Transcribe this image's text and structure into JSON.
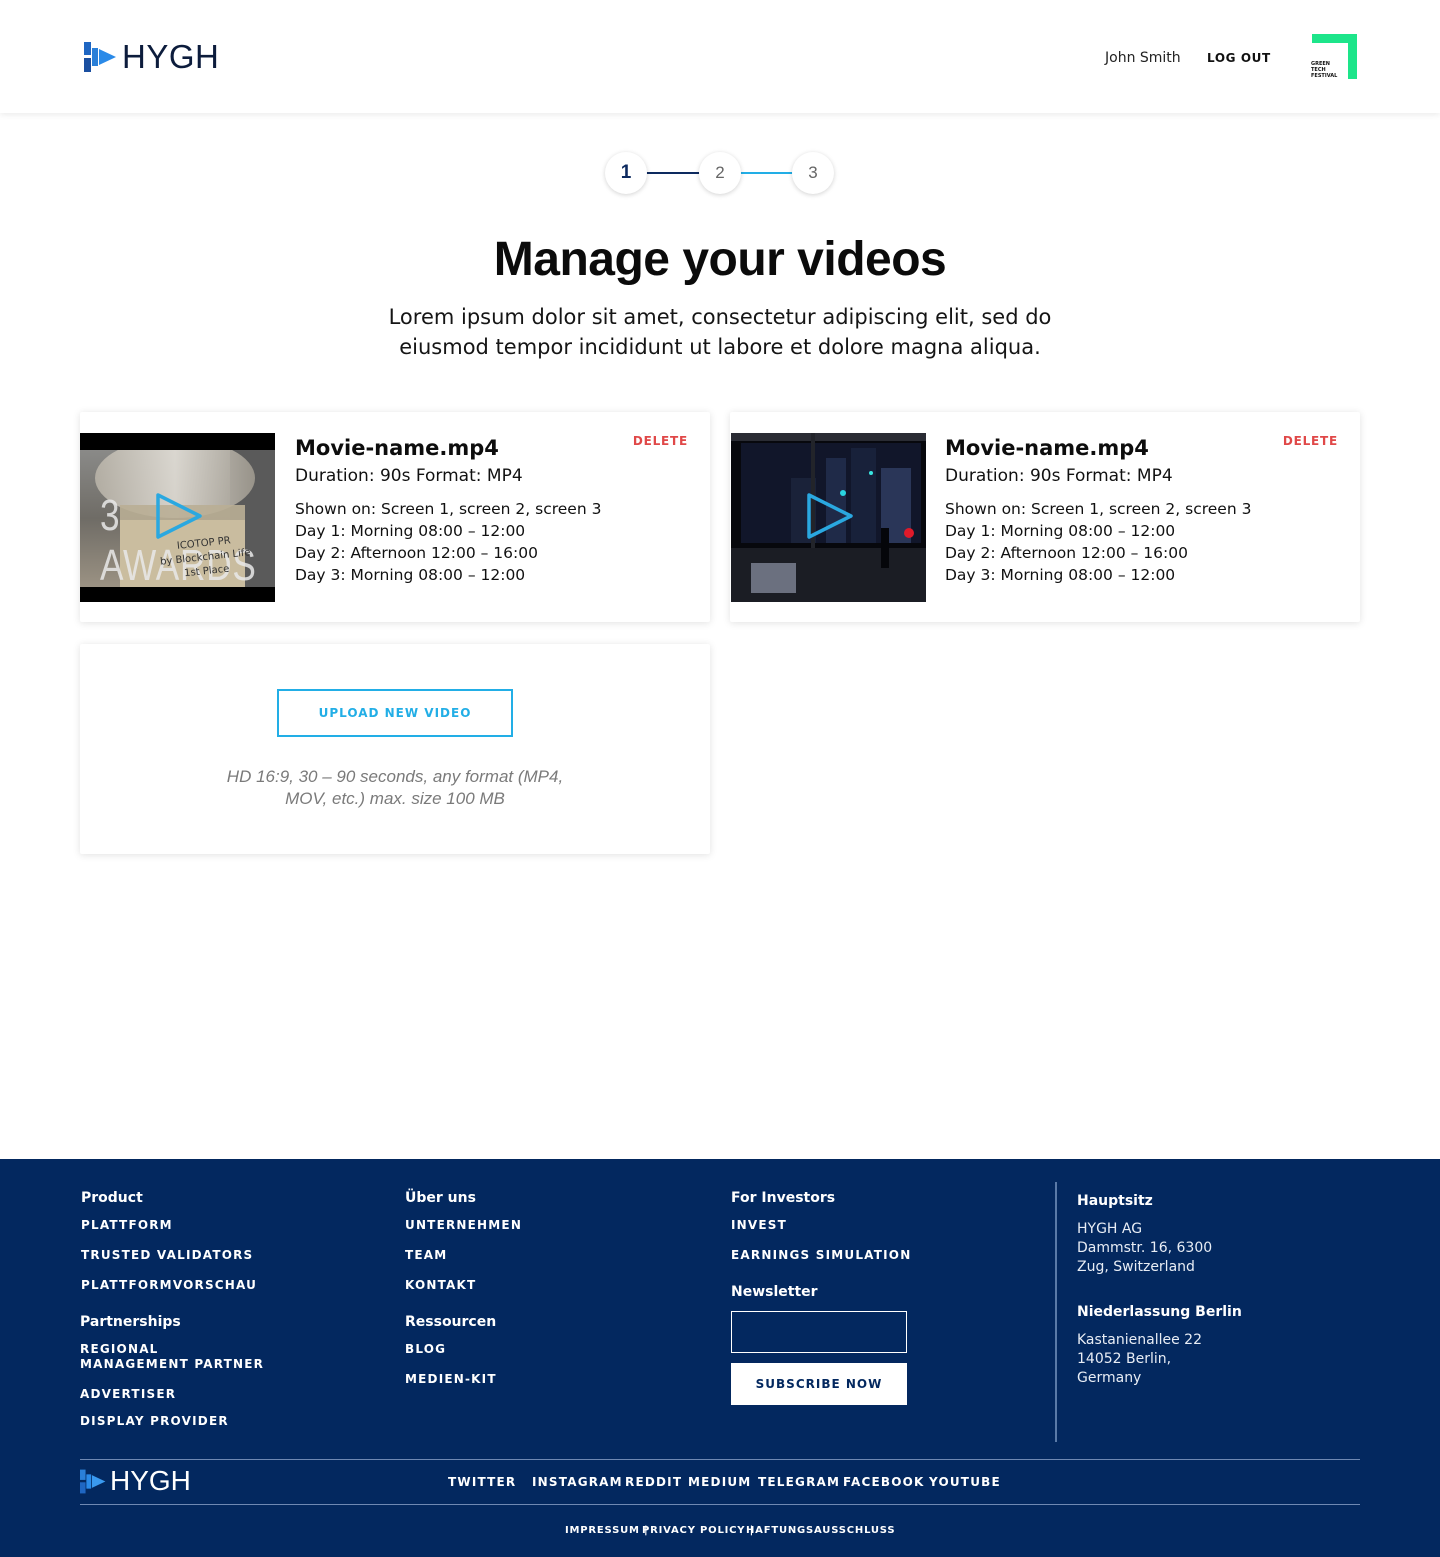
{
  "header": {
    "logo_text": "HYGH",
    "user_name": "John Smith",
    "logout_label": "LOG OUT",
    "partner_logo_lines": [
      "GREEN",
      "TECH",
      "FESTIVAL"
    ]
  },
  "stepper": {
    "steps": [
      "1",
      "2",
      "3"
    ],
    "active_step": 1
  },
  "page": {
    "title": "Manage your videos",
    "subtitle_line1": "Lorem ipsum dolor sit amet, consectetur adipiscing elit, sed do",
    "subtitle_line2": "eiusmod tempor incididunt ut labore et dolore magna aliqua."
  },
  "videos": [
    {
      "name": "Movie-name.mp4",
      "meta": "Duration: 90s Format: MP4",
      "shown_on": "Shown on: Screen 1, screen 2, screen 3",
      "day1": "Day 1: Morning 08:00 – 12:00",
      "day2": "Day 2: Afternoon 12:00 – 16:00",
      "day3": "Day 3: Morning 08:00 – 12:00",
      "delete_label": "DELETE",
      "thumb_caption": "3 AWARDS",
      "thumb_lines": [
        "ICOTOP PR",
        "by Blockchain Life",
        "1st Place"
      ]
    },
    {
      "name": "Movie-name.mp4",
      "meta": "Duration: 90s Format: MP4",
      "shown_on": "Shown on: Screen 1, screen 2, screen 3",
      "day1": "Day 1: Morning 08:00 – 12:00",
      "day2": "Day 2: Afternoon 12:00 – 16:00",
      "day3": "Day 3: Morning 08:00 – 12:00",
      "delete_label": "DELETE"
    }
  ],
  "upload": {
    "button_label": "UPLOAD NEW VIDEO",
    "hint_line1": "HD 16:9, 30 – 90 seconds, any format (MP4,",
    "hint_line2": "MOV, etc.) max. size 100 MB"
  },
  "footer": {
    "product": {
      "heading": "Product",
      "links": [
        "PLATTFORM",
        "TRUSTED VALIDATORS",
        "PLATTFORMVORSCHAU"
      ]
    },
    "partnerships": {
      "heading": "Partnerships",
      "links": [
        "REGIONAL MANAGEMENT PARTNER",
        "ADVERTISER",
        "DISPLAY PROVIDER"
      ]
    },
    "about": {
      "heading": "Über uns",
      "links": [
        "UNTERNEHMEN",
        "TEAM",
        "KONTAKT"
      ]
    },
    "resources": {
      "heading": "Ressourcen",
      "links": [
        "BLOG",
        "MEDIEN-KIT"
      ]
    },
    "investors": {
      "heading": "For Investors",
      "links": [
        "INVEST",
        "EARNINGS SIMULATION"
      ]
    },
    "newsletter": {
      "heading": "Newsletter",
      "input_placeholder": "",
      "button_label": "SUBSCRIBE NOW"
    },
    "hq": {
      "heading": "Hauptsitz",
      "line1": "HYGH AG",
      "line2": "Dammstr. 16, 6300",
      "line3": "Zug, Switzerland"
    },
    "berlin": {
      "heading": "Niederlassung Berlin",
      "line1": "Kastanienallee 22",
      "line2": "14052 Berlin,",
      "line3": "Germany"
    },
    "logo_text": "HYGH",
    "social": [
      "TWITTER",
      "INSTAGRAM",
      "REDDIT",
      "MEDIUM",
      "TELEGRAM",
      "FACEBOOK",
      "YOUTUBE"
    ],
    "legal": [
      "IMPRESSUM",
      "PRIVACY POLICY",
      "HAFTUNGSAUSSCHLUSS"
    ]
  },
  "colors": {
    "footer_bg": "#03285f",
    "accent_blue": "#22aee6",
    "delete_red": "#e04848",
    "green_accent": "#1de58a"
  }
}
